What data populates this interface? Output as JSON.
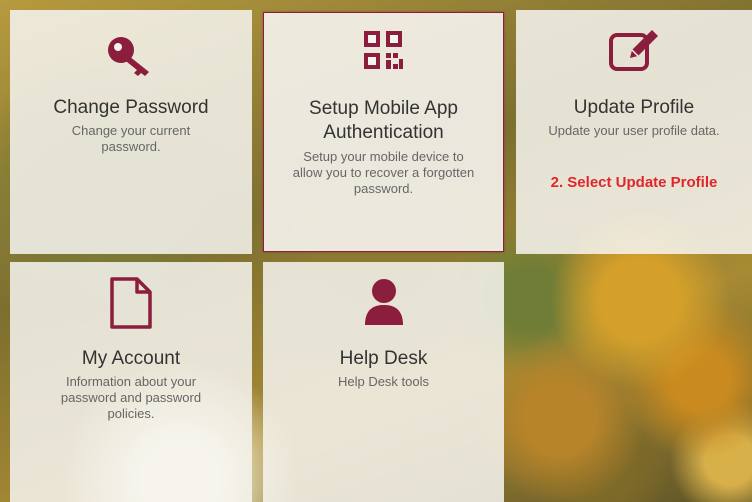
{
  "colors": {
    "accent": "#8b1d3d",
    "callout": "#e0262b"
  },
  "tiles": [
    {
      "icon": "key-icon",
      "title": "Change Password",
      "description": "Change your current password."
    },
    {
      "icon": "qr-code-icon",
      "title": "Setup Mobile App Authentication",
      "description": "Setup your mobile device to allow you to recover a forgotten password."
    },
    {
      "icon": "edit-icon",
      "title": "Update Profile",
      "description": "Update your user profile data."
    },
    {
      "icon": "document-icon",
      "title": "My Account",
      "description": "Information about your password and password policies."
    },
    {
      "icon": "person-icon",
      "title": "Help Desk",
      "description": "Help Desk tools"
    }
  ],
  "callout": "2. Select Update Profile"
}
